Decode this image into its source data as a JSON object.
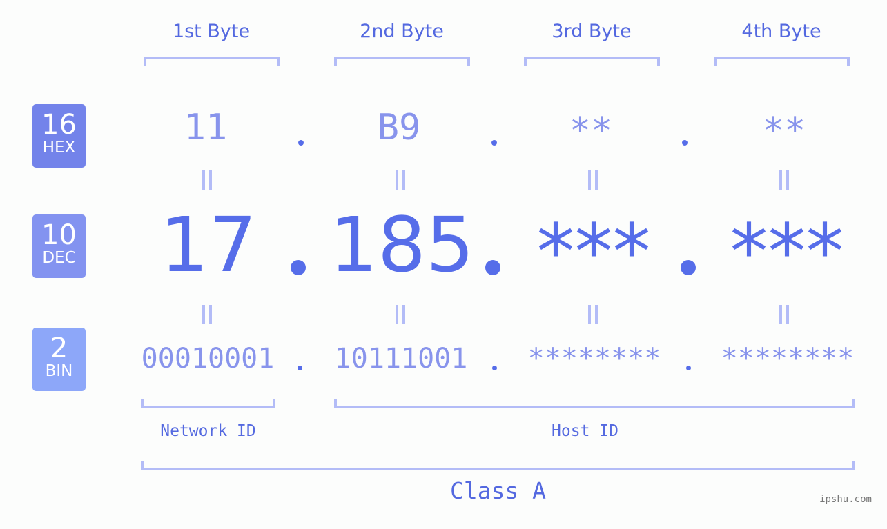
{
  "headers": [
    "1st Byte",
    "2nd Byte",
    "3rd Byte",
    "4th Byte"
  ],
  "bases": [
    {
      "num": "16",
      "label": "HEX",
      "color": "#7383ea"
    },
    {
      "num": "10",
      "label": "DEC",
      "color": "#8393f0"
    },
    {
      "num": "2",
      "label": "BIN",
      "color": "#8da7f9"
    }
  ],
  "hex": [
    "11",
    "B9",
    "**",
    "**"
  ],
  "dec": [
    "17",
    "185",
    "***",
    "***"
  ],
  "bin": [
    "00010001",
    "10111001",
    "********",
    "********"
  ],
  "separator": ".",
  "segments": {
    "network": "Network ID",
    "host": "Host ID"
  },
  "class_label": "Class A",
  "watermark": "ipshu.com",
  "colors": {
    "primary": "#566de9",
    "light": "#8894ec",
    "bracket": "#b3bcf7"
  }
}
